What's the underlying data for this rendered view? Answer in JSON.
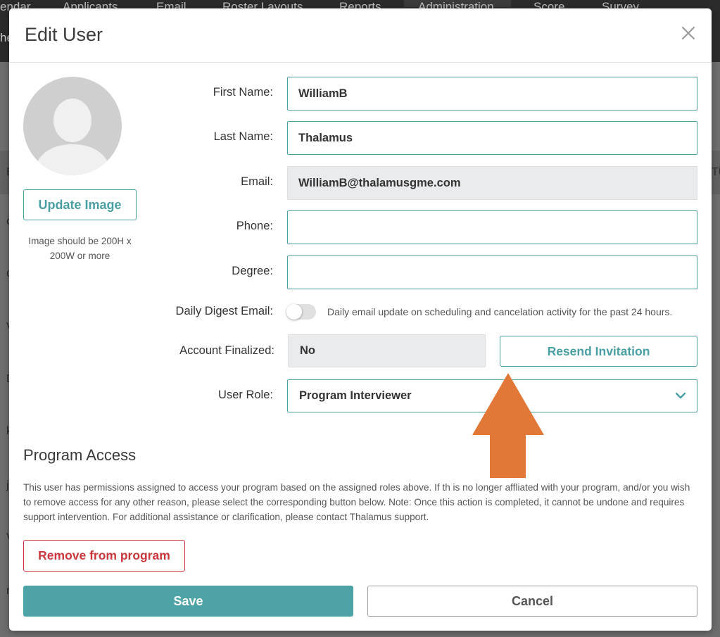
{
  "background": {
    "nav_items": [
      "endar",
      "Applicants",
      "Email",
      "Roster Layouts",
      "Reports",
      "Administration",
      "Score",
      "Survey"
    ],
    "side_text": "he",
    "left_letters": [
      "E",
      "c",
      "c",
      "V",
      "D",
      "k",
      "j",
      "V",
      "n"
    ],
    "right_letters": [
      "TU"
    ]
  },
  "modal": {
    "title": "Edit User",
    "close_icon": "close-icon"
  },
  "avatar": {
    "icon": "user-silhouette-icon",
    "update_label": "Update Image",
    "hint": "Image should be 200H x 200W or more"
  },
  "form": {
    "first_name": {
      "label": "First Name:",
      "value": "WilliamB"
    },
    "last_name": {
      "label": "Last Name:",
      "value": "Thalamus"
    },
    "email": {
      "label": "Email:",
      "value": "WilliamB@thalamusgme.com"
    },
    "phone": {
      "label": "Phone:",
      "value": ""
    },
    "degree": {
      "label": "Degree:",
      "value": ""
    },
    "daily_digest": {
      "label": "Daily Digest Email:",
      "enabled": false,
      "description": "Daily email update on scheduling and cancelation activity for the past 24 hours."
    },
    "account_finalized": {
      "label": "Account Finalized:",
      "value": "No",
      "resend_label": "Resend Invitation"
    },
    "user_role": {
      "label": "User Role:",
      "value": "Program Interviewer"
    }
  },
  "program_access": {
    "title": "Program Access",
    "text": "This user has permissions assigned to access your program based on the assigned roles above. If th is no longer affliated with your program, and/or you wish to remove access for any other reason, please select the corresponding button below. Note: Once this action is completed, it cannot be undone and requires support intervention. For additional assistance or clarification, please contact Thalamus support.",
    "remove_label": "Remove from program"
  },
  "footer": {
    "save_label": "Save",
    "cancel_label": "Cancel"
  },
  "colors": {
    "accent": "#4a9fa3",
    "danger": "#c9363b",
    "annotation_arrow": "#e27838"
  }
}
